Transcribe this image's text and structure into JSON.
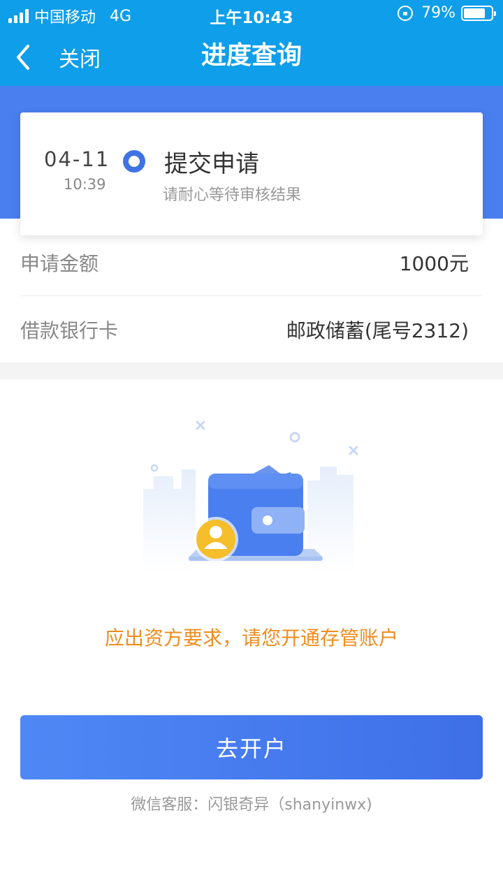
{
  "status_bar": {
    "carrier": "中国移动",
    "network": "4G",
    "time": "上午10:43",
    "battery": "79%",
    "battery_level": 0.79
  },
  "nav": {
    "back_label": "关闭",
    "title": "进度查询"
  },
  "progress": {
    "date": "04-11",
    "time": "10:39",
    "step_title": "提交申请",
    "step_subtitle": "请耐心等待审核结果"
  },
  "details": [
    {
      "label": "申请金额",
      "value": "1000元"
    },
    {
      "label": "借款银行卡",
      "value": "邮政储蓄(尾号2312)"
    }
  ],
  "notice": "应出资方要求，请您开通存管账户",
  "action_button": "去开户",
  "footer": "微信客服：闪银奇异（shanyinwx)",
  "colors": {
    "header": "#0f9ee9",
    "band": "#4a7ff0",
    "accent": "#3f73e3",
    "notice": "#f08c1e"
  }
}
